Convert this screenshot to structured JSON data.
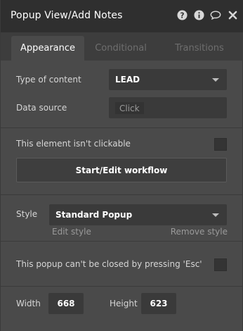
{
  "window": {
    "title": "Popup View/Add Notes"
  },
  "titlebar_icons": [
    {
      "name": "help-icon",
      "glyph": "?"
    },
    {
      "name": "info-icon",
      "glyph": "i"
    },
    {
      "name": "comment-icon",
      "glyph": "speech-bubble"
    },
    {
      "name": "close-icon",
      "glyph": "×"
    }
  ],
  "tabs": [
    {
      "label": "Appearance",
      "active": true
    },
    {
      "label": "Conditional",
      "active": false
    },
    {
      "label": "Transitions",
      "active": false
    }
  ],
  "content": {
    "type_label": "Type of content",
    "type_value": "LEAD",
    "source_label": "Data source",
    "source_placeholder": "Click"
  },
  "clickable": {
    "label": "This element isn't clickable",
    "checked": false,
    "workflow_button": "Start/Edit workflow"
  },
  "style": {
    "label": "Style",
    "value": "Standard Popup",
    "edit_link": "Edit style",
    "remove_link": "Remove style"
  },
  "esc": {
    "label": "This popup can't be closed by pressing 'Esc'",
    "checked": false
  },
  "size": {
    "width_label": "Width",
    "width_value": "668",
    "height_label": "Height",
    "height_value": "623"
  },
  "colors": {
    "panel_bg": "#4a4a4a",
    "titlebar_bg": "#2f2f2f",
    "field_bg": "#3a3a3a",
    "text": "#d6d6d6",
    "muted": "#9a9a9a"
  }
}
